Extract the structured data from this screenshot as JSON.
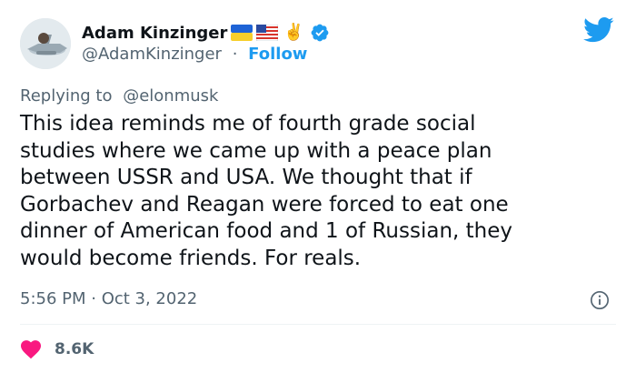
{
  "author": {
    "display_name": "Adam Kinzinger",
    "handle": "@AdamKinzinger",
    "separator": "·",
    "follow_label": "Follow",
    "emoji": "✌️"
  },
  "reply": {
    "prefix": "Replying to",
    "user": "@elonmusk"
  },
  "tweet": {
    "lines": [
      "This idea reminds me of fourth grade social",
      "studies where we came up with a peace plan",
      "between USSR and USA.  We thought that if",
      "Gorbachev and Reagan were forced to eat one",
      "dinner of American food and 1 of Russian, they",
      "would become friends.  For reals."
    ]
  },
  "meta": {
    "timestamp": "5:56 PM · Oct 3, 2022"
  },
  "engagement": {
    "likes": "8.6K"
  },
  "colors": {
    "accent": "#1d9bf0",
    "secondary_text": "#536471",
    "heart": "#f91880"
  },
  "icons": {
    "logo": "twitter-bird-icon",
    "verified": "verified-badge-icon",
    "info": "info-icon",
    "like": "heart-icon"
  }
}
